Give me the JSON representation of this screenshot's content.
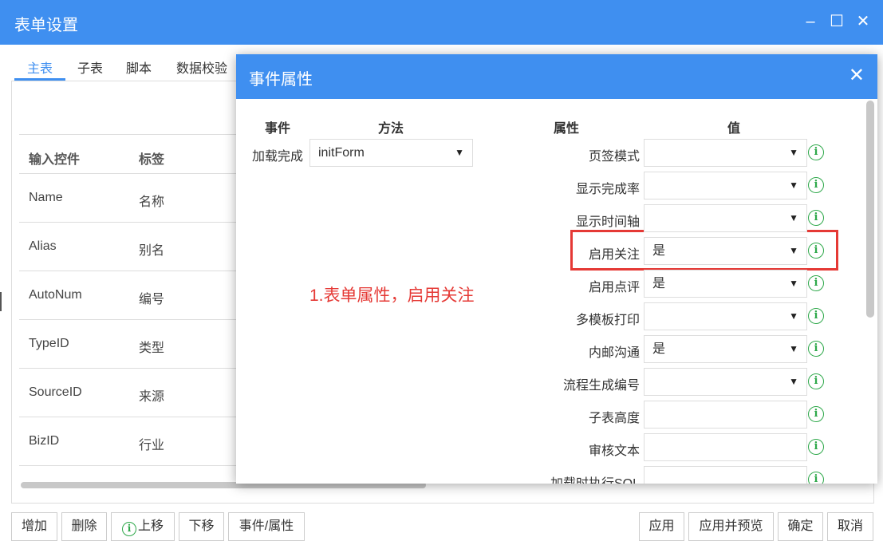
{
  "window": {
    "title": "表单设置",
    "minimize": "–",
    "maximize": "☐",
    "close": "✕"
  },
  "tabs": [
    "主表",
    "子表",
    "脚本",
    "数据校验"
  ],
  "grid": {
    "headers": [
      "输入控件",
      "标签"
    ],
    "rows": [
      [
        "Name",
        "名称"
      ],
      [
        "Alias",
        "别名"
      ],
      [
        "AutoNum",
        "编号"
      ],
      [
        "TypeID",
        "类型"
      ],
      [
        "SourceID",
        "来源"
      ],
      [
        "BizID",
        "行业"
      ]
    ]
  },
  "footer": {
    "left_buttons": [
      "增加",
      "删除",
      "上移",
      "下移",
      "事件/属性"
    ],
    "right_buttons": [
      "应用",
      "应用并预览",
      "确定",
      "取消"
    ]
  },
  "dialog": {
    "title": "事件属性",
    "close": "✕",
    "headers": {
      "event": "事件",
      "method": "方法",
      "property": "属性",
      "value": "值"
    },
    "event": {
      "label": "加载完成",
      "method": "initForm"
    },
    "properties": [
      {
        "label": "页签模式",
        "value": "",
        "type": "select"
      },
      {
        "label": "显示完成率",
        "value": "",
        "type": "select"
      },
      {
        "label": "显示时间轴",
        "value": "",
        "type": "select"
      },
      {
        "label": "启用关注",
        "value": "是",
        "type": "select"
      },
      {
        "label": "启用点评",
        "value": "是",
        "type": "select"
      },
      {
        "label": "多模板打印",
        "value": "",
        "type": "select"
      },
      {
        "label": "内邮沟通",
        "value": "是",
        "type": "select"
      },
      {
        "label": "流程生成编号",
        "value": "",
        "type": "select"
      },
      {
        "label": "子表高度",
        "value": "",
        "type": "text"
      },
      {
        "label": "审核文本",
        "value": "",
        "type": "text"
      },
      {
        "label": "加载时执行SQL",
        "value": "",
        "type": "text"
      }
    ],
    "annotation": "1.表单属性，启用关注",
    "info_glyph": "i",
    "arrow_glyph": "▼"
  }
}
